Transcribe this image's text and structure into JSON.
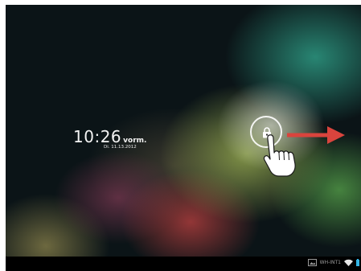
{
  "lockscreen": {
    "time": "10:26",
    "ampm": "vorm.",
    "date": "Di. 11.13.2012",
    "lock_icon": "lock-icon",
    "hand_icon": "pointing-hand-icon",
    "arrow_icon": "arrow-right-icon"
  },
  "statusbar": {
    "network_label": "WH-INT1",
    "gallery_icon": "gallery-icon",
    "wifi_icon": "wifi-icon",
    "battery_icon": "battery-icon"
  },
  "colors": {
    "accent_arrow": "#d9443d",
    "lock_ring": "#ffffff",
    "navbar": "#000000"
  }
}
